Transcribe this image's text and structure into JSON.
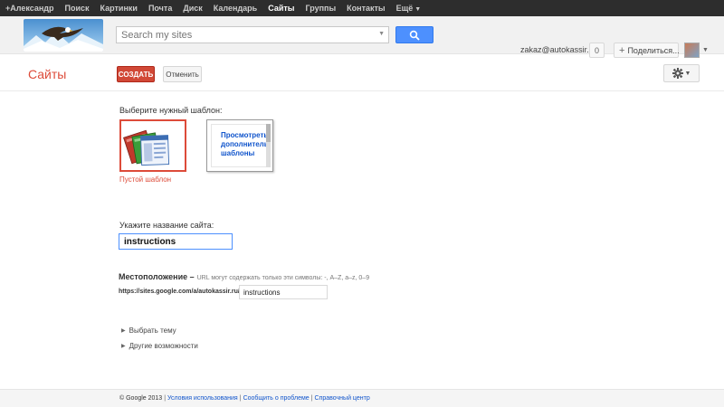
{
  "topbar": {
    "items": [
      "+Александр",
      "Поиск",
      "Картинки",
      "Почта",
      "Диск",
      "Календарь",
      "Сайты",
      "Группы",
      "Контакты",
      "Ещё"
    ],
    "active_index": 6
  },
  "header": {
    "search_placeholder": "Search my sites",
    "account_email": "zakaz@autokassir.ru",
    "notification_count": "0",
    "share_label": "Поделиться..."
  },
  "subheader": {
    "title": "Сайты",
    "create_label": "СОЗДАТЬ",
    "cancel_label": "Отменить"
  },
  "main": {
    "template_prompt": "Выберите нужный шаблон:",
    "template_blank_caption": "Пустой шаблон",
    "template_more_text": "Просмотреть дополнитель шаблоны",
    "site_name_prompt": "Укажите название сайта:",
    "site_name_value": "instructions",
    "location_label": "Местоположение –",
    "location_hint": "URL могут содержать только эти символы: -, A–Z, a–z, 0–9",
    "url_prefix": "https://sites.google.com/a/autokassir.ru/",
    "url_value": "instructions",
    "expander_theme": "Выбрать тему",
    "expander_more": "Другие возможности"
  },
  "footer": {
    "copyright": "© Google 2013",
    "links": [
      "Условия использования",
      "Сообщить о проблеме",
      "Справочный центр"
    ]
  },
  "colors": {
    "accent_red": "#dd4b39",
    "search_blue": "#4d90fe",
    "topbar_bg": "#2d2d2d",
    "link_blue": "#1155cc"
  }
}
